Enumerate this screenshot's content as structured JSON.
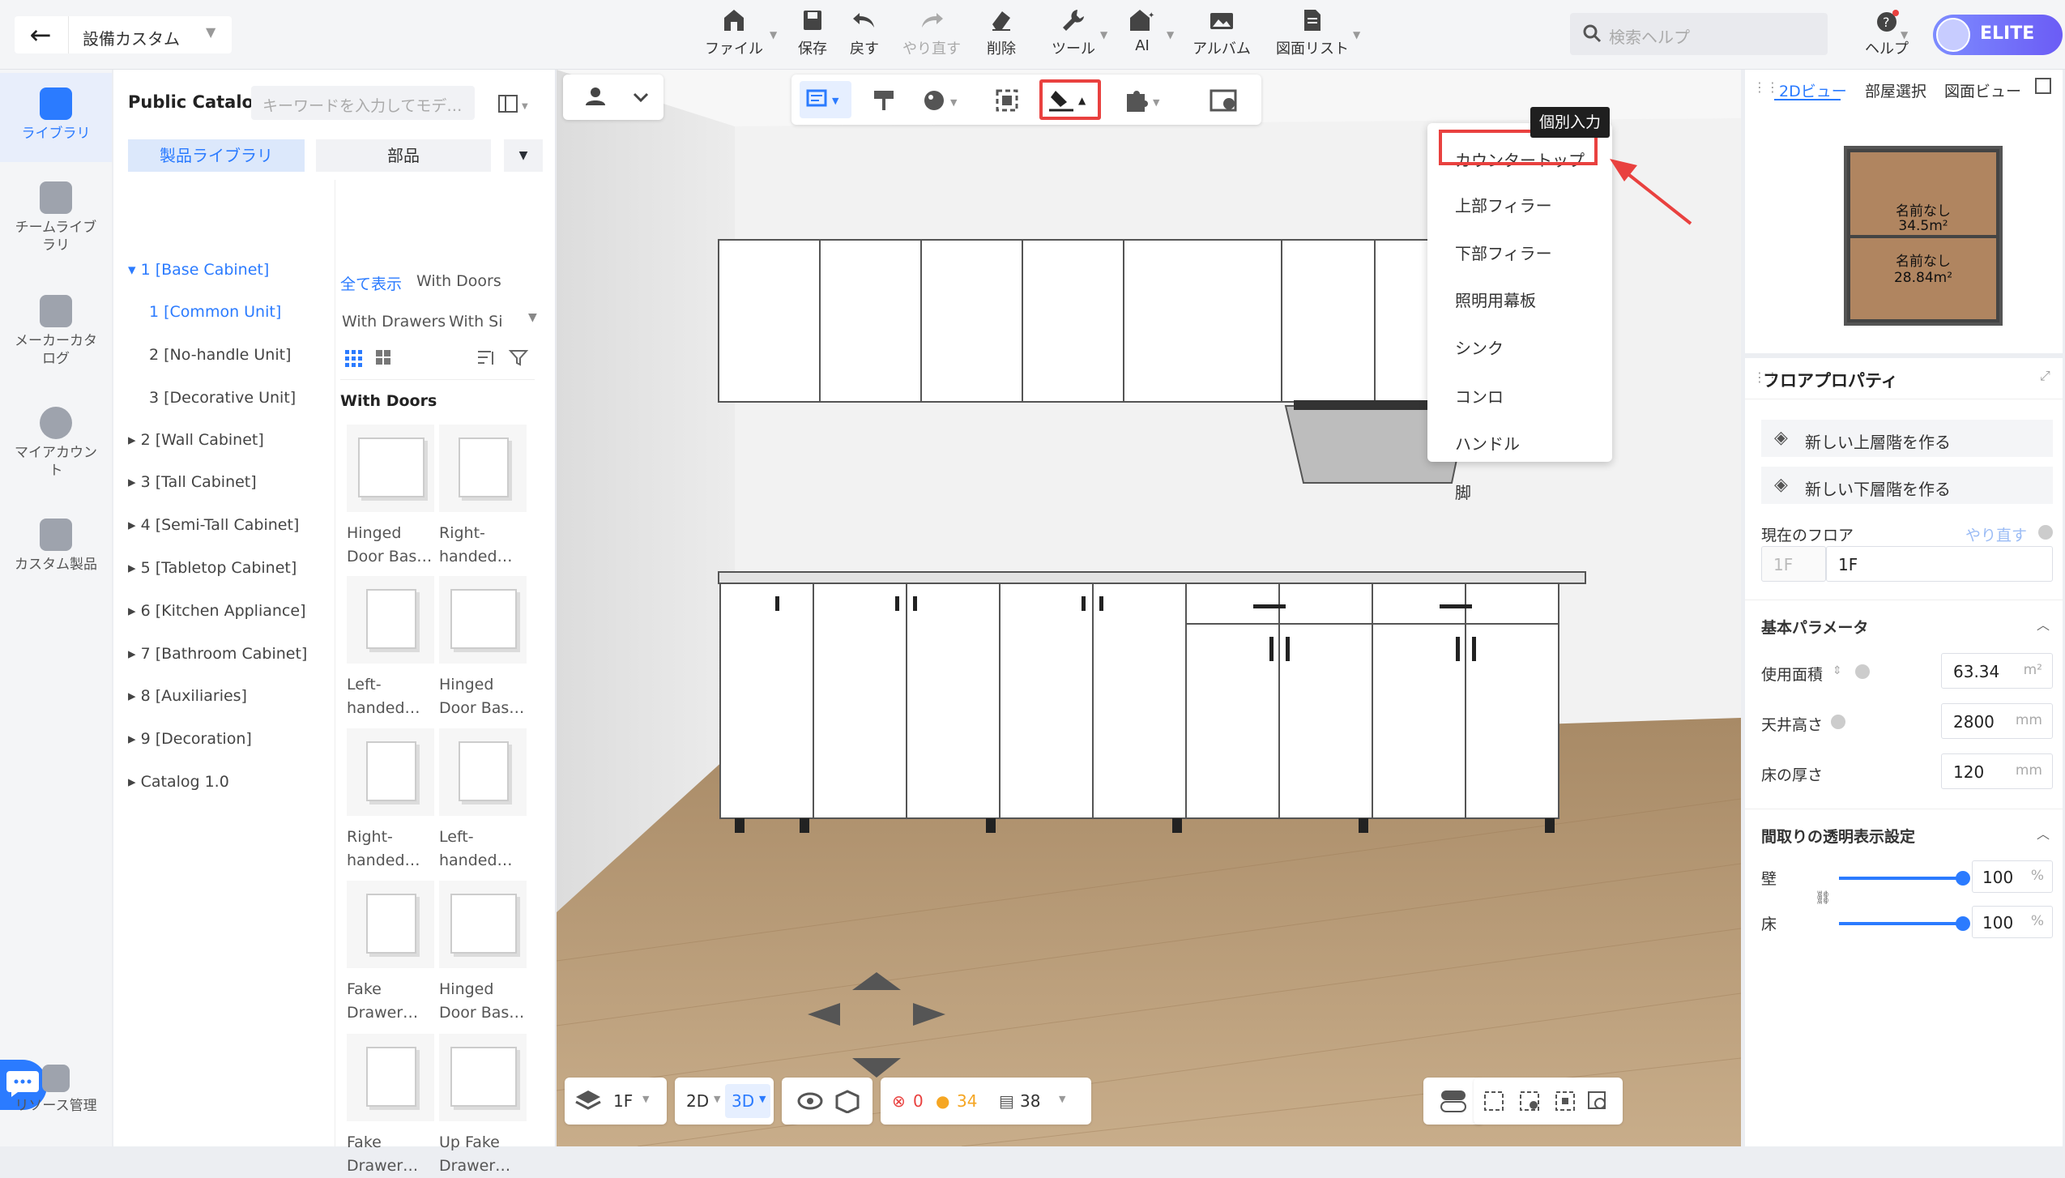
{
  "topbar": {
    "back_icon": "arrow-left-icon",
    "project_title": "設備カスタム",
    "tools": [
      {
        "label": "ファイル",
        "icon": "house-file-icon"
      },
      {
        "label": "保存",
        "icon": "save-icon"
      },
      {
        "label": "戻す",
        "icon": "undo-icon"
      },
      {
        "label": "やり直す",
        "icon": "redo-icon"
      },
      {
        "label": "削除",
        "icon": "eraser-icon"
      },
      {
        "label": "ツール",
        "icon": "wrench-icon"
      },
      {
        "label": "AI",
        "icon": "ai-house-icon"
      },
      {
        "label": "アルバム",
        "icon": "album-icon"
      },
      {
        "label": "図面リスト",
        "icon": "drawing-list-icon"
      }
    ],
    "search_placeholder": "検索ヘルプ",
    "help_label": "ヘルプ",
    "elite_label": "ELITE"
  },
  "rail": {
    "items": [
      {
        "label": "ライブラリ",
        "icon": "library-icon",
        "active": true
      },
      {
        "label": "チームライブ\nラリ",
        "icon": "team-library-icon"
      },
      {
        "label": "メーカーカタ\nログ",
        "icon": "maker-catalog-icon"
      },
      {
        "label": "マイアカウン\nト",
        "icon": "account-icon"
      },
      {
        "label": "カスタム製品",
        "icon": "custom-product-icon"
      }
    ],
    "resource_label": "リソース管理"
  },
  "catalog": {
    "title": "Public Catalog",
    "search_placeholder": "キーワードを入力してモデ…",
    "tab_library": "製品ライブラリ",
    "tab_parts": "部品",
    "tree": [
      {
        "label": "1 [Base Cabinet]",
        "selected": true,
        "expanded": true
      },
      {
        "label": "1 [Common Unit]",
        "selected": true,
        "child": true
      },
      {
        "label": "2 [No-handle Unit]",
        "child": true
      },
      {
        "label": "3 [Decorative Unit]",
        "child": true
      },
      {
        "label": "2 [Wall Cabinet]"
      },
      {
        "label": "3 [Tall Cabinet]"
      },
      {
        "label": "4 [Semi-Tall Cabinet]"
      },
      {
        "label": "5 [Tabletop Cabinet]"
      },
      {
        "label": "6 [Kitchen Appliance]"
      },
      {
        "label": "7 [Bathroom Cabinet]"
      },
      {
        "label": "8 [Auxiliaries]"
      },
      {
        "label": "9 [Decoration]"
      },
      {
        "label": "Catalog 1.0"
      }
    ],
    "filters": [
      "全て表示",
      "With Doors",
      "With Drawers",
      "With Si"
    ],
    "section_title": "With Doors",
    "products": [
      {
        "l1": "Hinged",
        "l2": "Door Bas…"
      },
      {
        "l1": "Right-",
        "l2": "handed…"
      },
      {
        "l1": "Left-",
        "l2": "handed…"
      },
      {
        "l1": "Hinged",
        "l2": "Door Bas…"
      },
      {
        "l1": "Right-",
        "l2": "handed…"
      },
      {
        "l1": "Left-",
        "l2": "handed…"
      },
      {
        "l1": "Fake",
        "l2": "Drawer…"
      },
      {
        "l1": "Hinged",
        "l2": "Door Bas…"
      },
      {
        "l1": "Fake",
        "l2": "Drawer…"
      },
      {
        "l1": "Up Fake",
        "l2": "Drawer…"
      }
    ]
  },
  "viewport_toolbar": {
    "tooltip": "個別入力",
    "menu": [
      "カウンタートップ",
      "上部フィラー",
      "下部フィラー",
      "照明用幕板",
      "シンク",
      "コンロ",
      "ハンドル",
      "脚"
    ],
    "highlight_color": "#e9413f"
  },
  "bottom": {
    "floor": "1F",
    "mode_2d": "2D",
    "mode_3d": "3D",
    "errors": "0",
    "warnings": "34",
    "items": "38"
  },
  "right_panel": {
    "tabs": [
      "2Dビュー",
      "部屋選択",
      "図面ビュー"
    ],
    "rooms": [
      {
        "name": "名前なし",
        "area": "34.5m²"
      },
      {
        "name": "名前なし",
        "area": "28.84m²"
      }
    ],
    "floor_props_title": "フロアプロパティ",
    "btn_upper": "新しい上層階を作る",
    "btn_lower": "新しい下層階を作る",
    "current_floor_label": "現在のフロア",
    "redo_label": "やり直す",
    "floor_prefix": "1F",
    "floor_value": "1F",
    "basic_params_title": "基本パラメータ",
    "area_label": "使用面積",
    "area_value": "63.34",
    "area_unit": "m²",
    "ceiling_label": "天井高さ",
    "ceiling_value": "2800",
    "ceiling_unit": "mm",
    "floor_thick_label": "床の厚さ",
    "floor_thick_value": "120",
    "floor_thick_unit": "mm",
    "transparency_title": "間取りの透明表示設定",
    "wall_label": "壁",
    "wall_value": "100",
    "floor_label": "床",
    "floor_tr_value": "100",
    "percent": "%"
  }
}
